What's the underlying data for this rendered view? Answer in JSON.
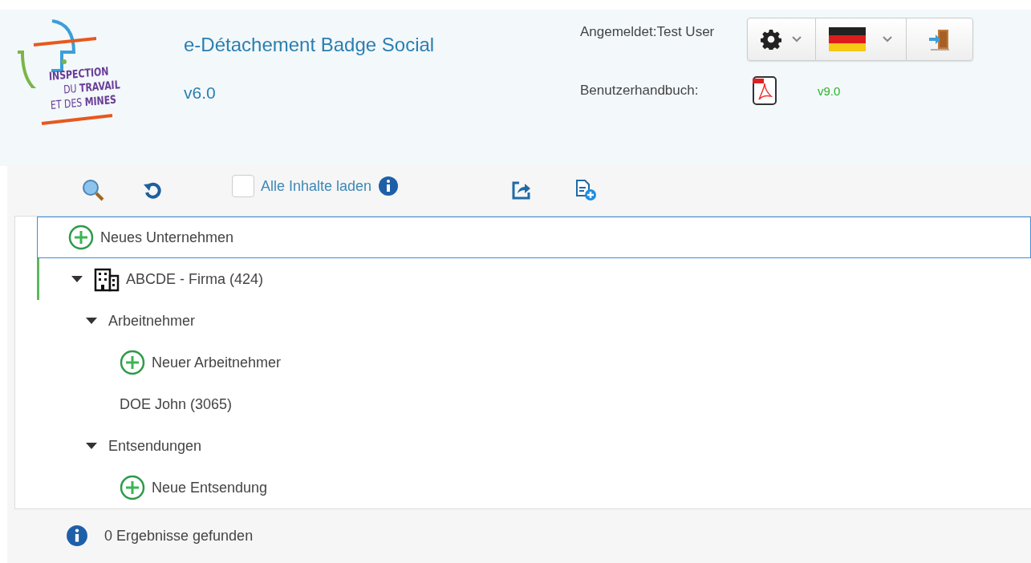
{
  "logo": {
    "lines": [
      "INSPECTION",
      "DU **TRAVAIL**",
      "ET DES **MINES**"
    ]
  },
  "app": {
    "title": "e-Détachement Badge Social",
    "version": "v6.0"
  },
  "user": {
    "logged_in": "Angemeldet:Test User",
    "manual_label": "Benutzerhandbuch:",
    "manual_version": "v9.0"
  },
  "toolbar": {
    "load_all": {
      "label": "Alle Inhalte laden",
      "checked": false
    }
  },
  "tree": [
    {
      "kind": "add",
      "label": "Neues Unternehmen",
      "selected": true
    },
    {
      "kind": "company",
      "label": "ABCDE - Firma (424)",
      "selected": false,
      "expanded": true,
      "children": [
        {
          "kind": "group",
          "label": "Arbeitnehmer",
          "expanded": true,
          "children": [
            {
              "kind": "add",
              "label": "Neuer Arbeitnehmer"
            },
            {
              "kind": "leaf",
              "label": "DOE John (3065)"
            }
          ]
        },
        {
          "kind": "group",
          "label": "Entsendungen",
          "expanded": true,
          "children": [
            {
              "kind": "add",
              "label": "Neue Entsendung"
            }
          ]
        }
      ]
    }
  ],
  "status": "0 Ergebnisse gefunden"
}
